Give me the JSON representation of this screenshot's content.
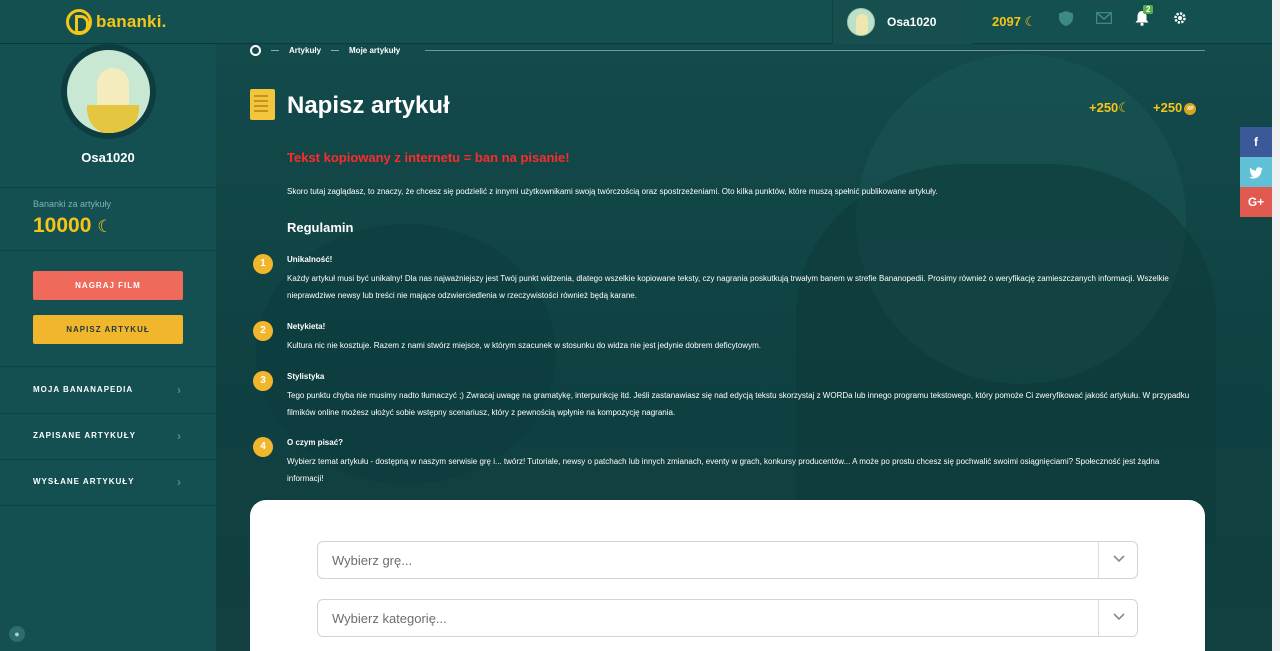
{
  "header": {
    "logo_text": "bananki.",
    "username": "Osa1020",
    "coins": "2097",
    "notifications_count": "2"
  },
  "sidebar": {
    "username": "Osa1020",
    "stat_label": "Bananki za artykuły",
    "stat_value": "10000",
    "buttons": {
      "record": "NAGRAJ FILM",
      "write": "NAPISZ ARTYKUŁ"
    },
    "menu": [
      {
        "label": "MOJA BANANAPEDIA"
      },
      {
        "label": "ZAPISANE ARTYKUŁY"
      },
      {
        "label": "WYSŁANE ARTYKUŁY"
      }
    ]
  },
  "breadcrumb": {
    "items": [
      "Artykuły",
      "Moje artykuły"
    ]
  },
  "page": {
    "title": "Napisz artykuł",
    "reward_coins": "+250",
    "reward_xp": "+250",
    "xp_label": "XP",
    "warning": "Tekst kopiowany z internetu = ban na pisanie!",
    "intro": "Skoro tutaj zaglądasz, to znaczy, że chcesz się podzielić z innymi użytkownikami swoją twórczością oraz spostrzeżeniami. Oto kilka punktów, które muszą spełnić publikowane artykuły.",
    "rules_title": "Regulamin",
    "rules": [
      {
        "num": "1",
        "title": "Unikalność!",
        "text": "Każdy artykuł musi być unikalny! Dla nas najważniejszy jest Twój punkt widzenia, dlatego wszelkie kopiowane teksty, czy nagrania poskutkują trwałym banem w strefie Bananopedii. Prosimy również o weryfikację zamieszczanych informacji. Wszelkie nieprawdziwe newsy lub treści nie mające odzwierciedlenia w rzeczywistości również będą karane."
      },
      {
        "num": "2",
        "title": "Netykieta!",
        "text": "Kultura nic nie kosztuje. Razem z nami stwórz miejsce, w którym szacunek w stosunku do widza nie jest jedynie dobrem deficytowym."
      },
      {
        "num": "3",
        "title": "Stylistyka",
        "text": "Tego punktu chyba nie musimy nadto tłumaczyć ;) Zwracaj uwagę na gramatykę, interpunkcję itd. Jeśli zastanawiasz się nad edycją tekstu skorzystaj z WORDa lub innego programu tekstowego, który pomoże Ci zweryfikować jakość artykułu. W przypadku filmików online możesz ułożyć sobie wstępny scenariusz, który z pewnością wpłynie na kompozycję nagrania."
      },
      {
        "num": "4",
        "title": "O czym pisać?",
        "text": "Wybierz temat artykułu - dostępną w naszym serwisie grę i... twórz! Tutoriale, newsy o patchach lub innych zmianach, eventy w grach, konkursy producentów... A może po prostu chcesz się pochwalić swoimi osiągnięciami? Społeczność jest żądna informacji!"
      }
    ]
  },
  "form": {
    "game_placeholder": "Wybierz grę...",
    "category_placeholder": "Wybierz kategorię..."
  },
  "social": {
    "facebook": "f",
    "twitter": "t",
    "googleplus": "G+"
  },
  "colors": {
    "accent_yellow": "#f5c518",
    "warning_red": "#ff2b2b",
    "button_red": "#ef6a5a",
    "button_yellow": "#f2b62d",
    "bg_teal": "#0f4446"
  }
}
